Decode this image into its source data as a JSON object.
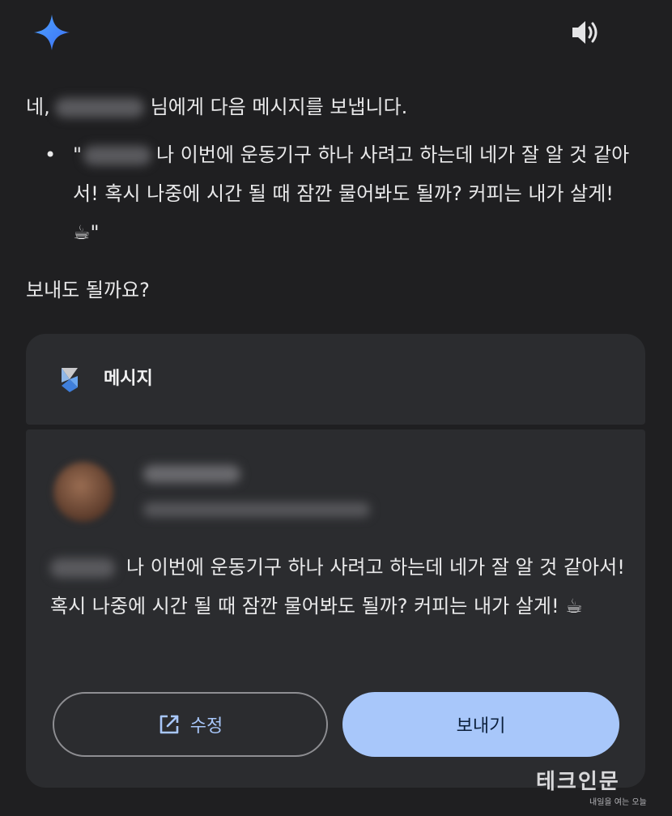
{
  "reply": {
    "prefix": "네,",
    "suffix": "님에게 다음 메시지를 보냅니다.",
    "quote_open": "\"",
    "quote_text": "나 이번에 운동기구 하나 사려고 하는데 네가 잘 알 것 같아서! 혹시 나중에 시간 될 때 잠깐 물어봐도 될까? 커피는 내가 살게! ☕\"",
    "confirm": "보내도 될까요?"
  },
  "card": {
    "app_name": "메시지",
    "message_text": "나 이번에 운동기구 하나 사려고 하는데 네가 잘 알 것 같아서! 혹시 나중에 시간 될 때 잠깐 물어봐도 될까? 커피는 내가 살게! ☕",
    "edit_label": "수정",
    "send_label": "보내기"
  },
  "watermark": {
    "main": "테크인문",
    "sub": "내일을 여는 오늘"
  },
  "colors": {
    "background": "#1f1f21",
    "card": "#2b2c2f",
    "accent": "#a8c7fa"
  },
  "icons": {
    "assistant": "gemini-sparkle-icon",
    "audio": "speaker-icon",
    "app": "messages-app-icon",
    "edit": "open-external-icon"
  }
}
